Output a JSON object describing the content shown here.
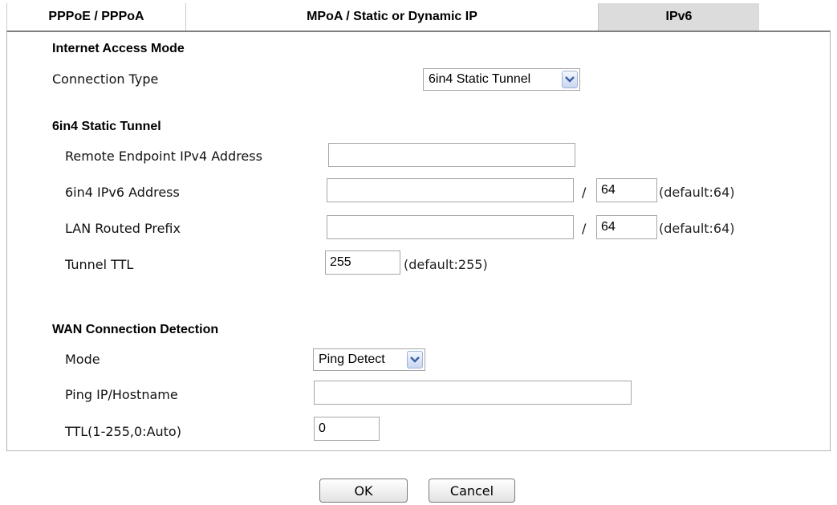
{
  "tabs": [
    {
      "label": "PPPoE / PPPoA",
      "active": false
    },
    {
      "label": "MPoA / Static or Dynamic IP",
      "active": false
    },
    {
      "label": "IPv6",
      "active": true
    }
  ],
  "internet_access_mode": {
    "title": "Internet Access Mode",
    "connection_type_label": "Connection Type",
    "connection_type_value": "6in4 Static Tunnel"
  },
  "static_tunnel": {
    "title": "6in4 Static Tunnel",
    "remote_endpoint_label": "Remote Endpoint IPv4 Address",
    "remote_endpoint_value": "",
    "ipv6_address_label": "6in4 IPv6 Address",
    "ipv6_address_value": "",
    "ipv6_prefix_value": "64",
    "ipv6_prefix_hint": "(default:64)",
    "lan_prefix_label": "LAN Routed Prefix",
    "lan_prefix_value": "",
    "lan_prefix_len_value": "64",
    "lan_prefix_hint": "(default:64)",
    "slash": "/",
    "ttl_label": "Tunnel TTL",
    "ttl_value": "255",
    "ttl_hint": "(default:255)"
  },
  "wan_detection": {
    "title": "WAN Connection Detection",
    "mode_label": "Mode",
    "mode_value": "Ping Detect",
    "ping_label": "Ping IP/Hostname",
    "ping_value": "",
    "ttl_label": "TTL(1-255,0:Auto)",
    "ttl_value": "0"
  },
  "buttons": {
    "ok": "OK",
    "cancel": "Cancel"
  },
  "colors": {
    "active_tab": "#dcdcdc",
    "select_arrow": "#3a5fa8"
  },
  "icons": {
    "dropdown": "chevron-down-icon"
  }
}
